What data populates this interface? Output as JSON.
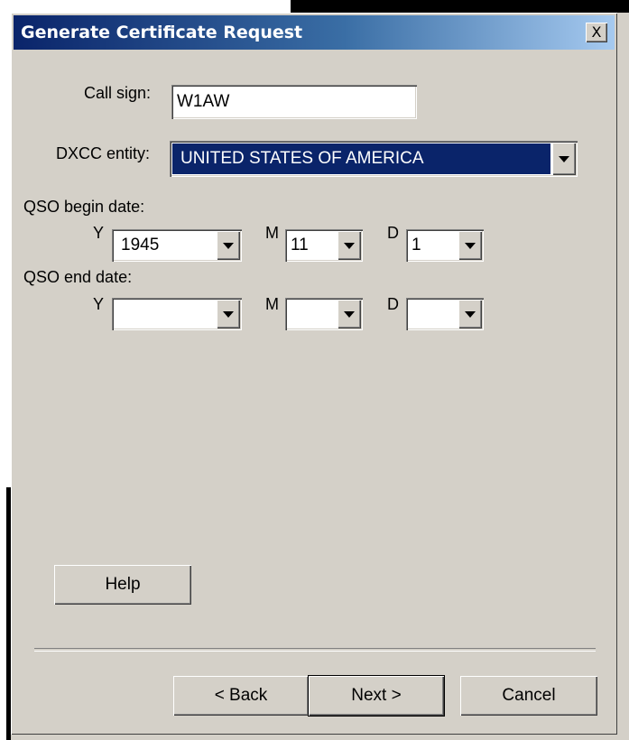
{
  "window": {
    "title": "Generate Certificate Request",
    "close_label": "X"
  },
  "form": {
    "call_sign_label": "Call sign:",
    "call_sign_value": "W1AW",
    "dxcc_label": "DXCC entity:",
    "dxcc_value": "UNITED STATES OF AMERICA",
    "begin_label": "QSO begin date:",
    "end_label": "QSO end date:",
    "begin": {
      "y_label": "Y",
      "y_value": "1945",
      "m_label": "M",
      "m_value": "11",
      "d_label": "D",
      "d_value": "1"
    },
    "end": {
      "y_label": "Y",
      "y_value": "",
      "m_label": "M",
      "m_value": "",
      "d_label": "D",
      "d_value": ""
    }
  },
  "buttons": {
    "help": "Help",
    "back": "< Back",
    "next": "Next >",
    "cancel": "Cancel"
  },
  "icons": {
    "dropdown": "chevron-down-icon",
    "close": "close-icon"
  },
  "colors": {
    "title_gradient_start": "#0a246a",
    "title_gradient_end": "#a6caf0",
    "selection": "#0a246a",
    "face": "#d4d0c8"
  }
}
